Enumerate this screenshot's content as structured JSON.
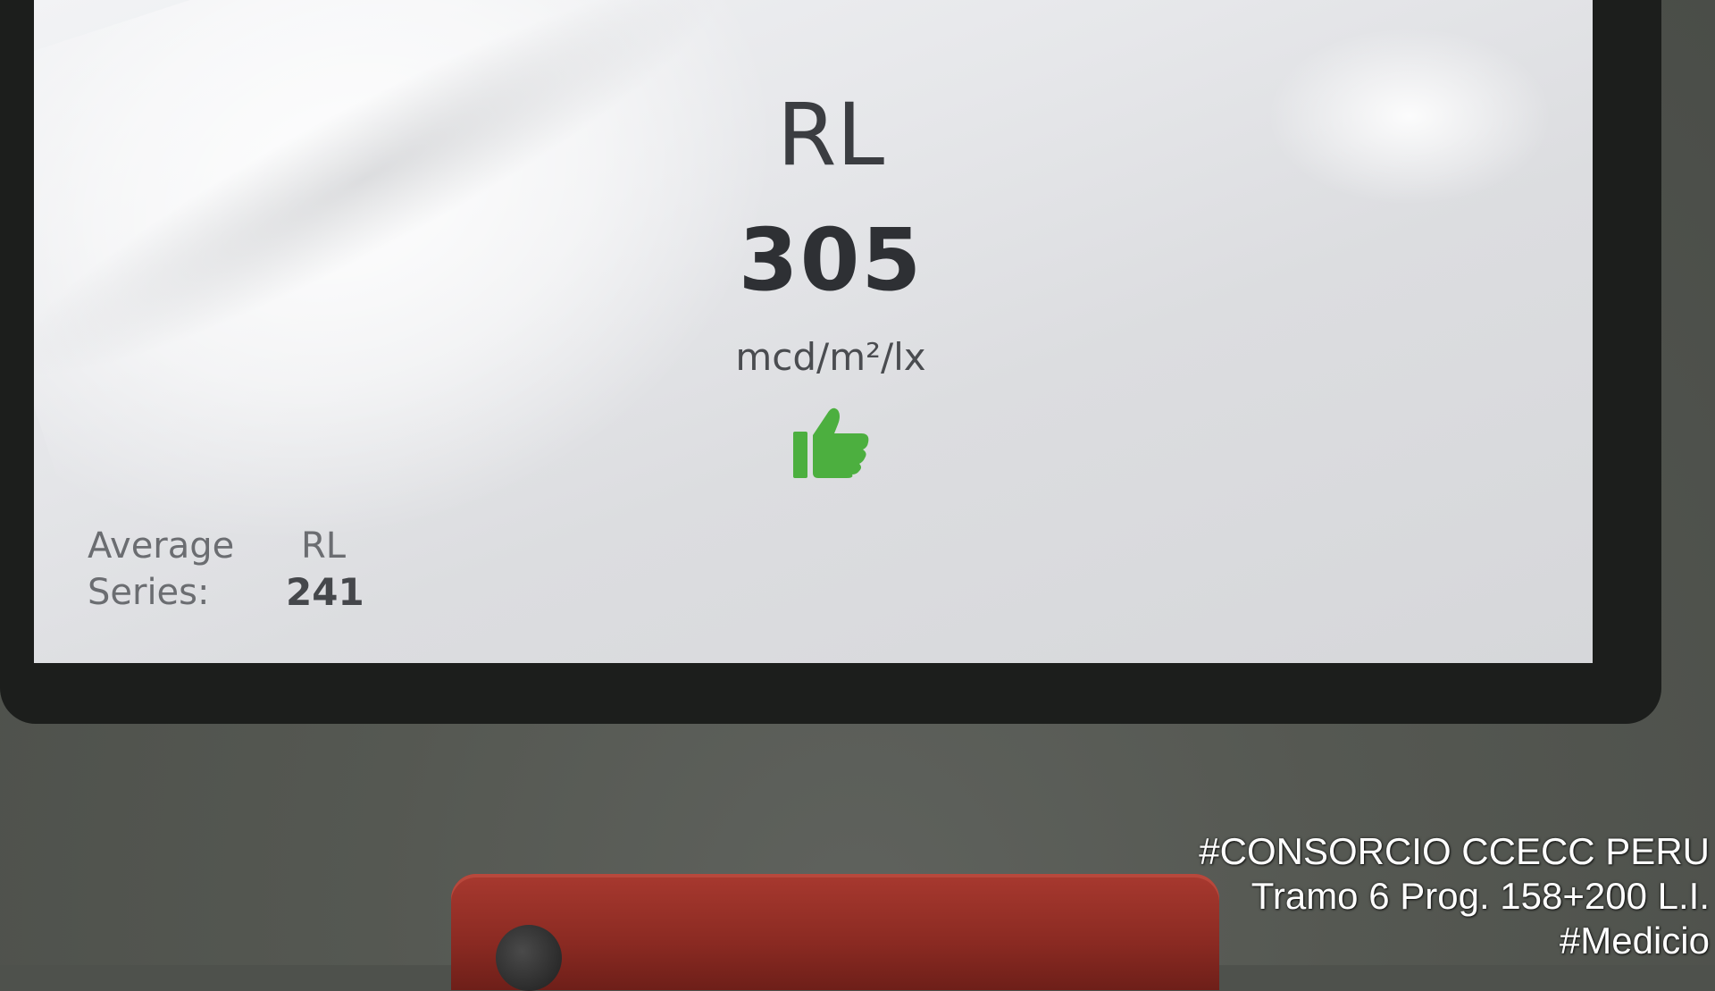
{
  "display": {
    "metric_title": "RL",
    "reading_value": "305",
    "unit": "mcd/m²/lx",
    "status_icon": "thumbs-up-icon",
    "status_color": "#4caf3f"
  },
  "average_series": {
    "label_line1": "Average",
    "label_line2": "Series:",
    "metric": "RL",
    "value": "241"
  },
  "watermark": {
    "line1": "#CONSORCIO CCECC PERU",
    "line2": "Tramo 6 Prog. 158+200 L.I.",
    "line3": "#Medicio"
  },
  "colors": {
    "button": "#8a2a22",
    "housing": "#4e514c"
  }
}
